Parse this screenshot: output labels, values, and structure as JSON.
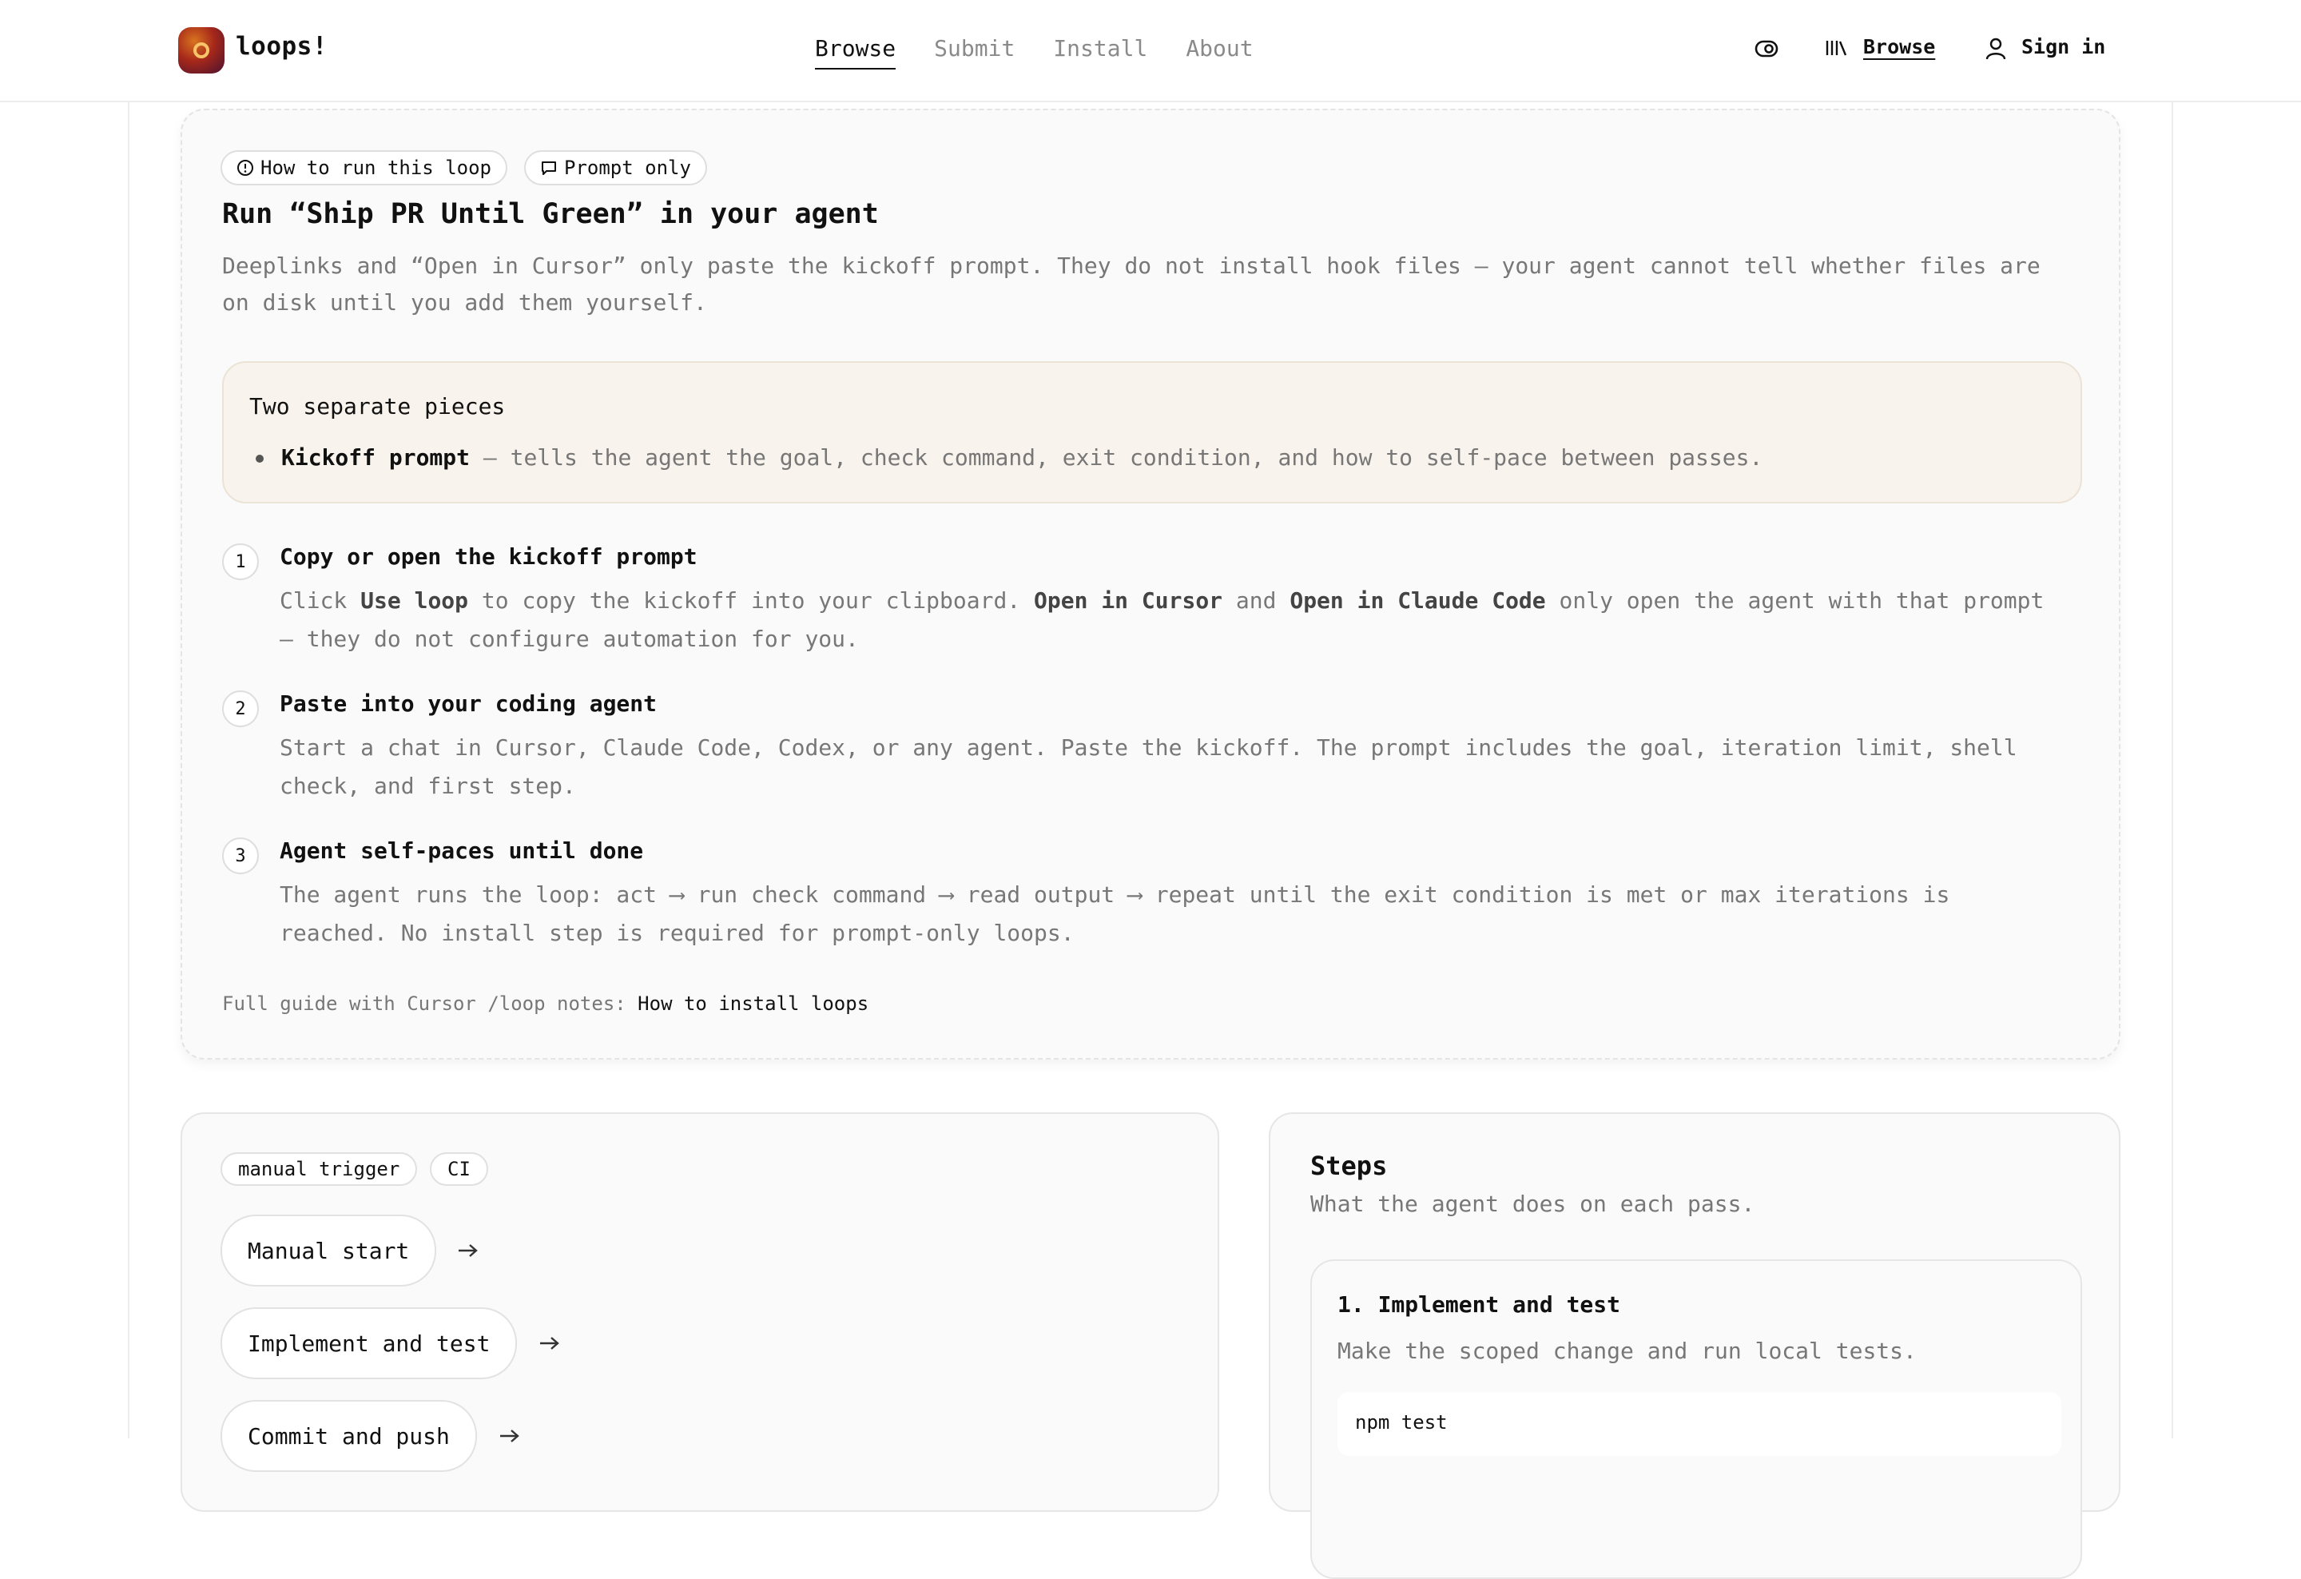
{
  "brand": {
    "name": "loops!"
  },
  "nav": {
    "items": [
      {
        "label": "Browse",
        "active": true
      },
      {
        "label": "Submit"
      },
      {
        "label": "Install"
      },
      {
        "label": "About"
      }
    ]
  },
  "header_right": {
    "browse_label": "Browse",
    "signin_label": "Sign in"
  },
  "howto": {
    "chip_run": "How to run this loop",
    "chip_prompt": "Prompt only",
    "title": "Run “Ship PR Until Green” in your agent",
    "description": "Deeplinks and “Open in Cursor” only paste the kickoff prompt. They do not install hook files — your agent cannot tell whether files are on disk until you add them yourself.",
    "pieces": {
      "title": "Two separate pieces",
      "item_bold": "Kickoff prompt",
      "item_text": " — tells the agent the goal, check command, exit condition, and how to self-pace between passes."
    },
    "steps": [
      {
        "num": "1",
        "title": "Copy or open the kickoff prompt",
        "p1": "Click ",
        "b1": "Use loop",
        "p2": " to copy the kickoff into your clipboard. ",
        "b2": "Open in Cursor",
        "p3": " and ",
        "b3": "Open in Claude Code",
        "p4": " only open the agent with that prompt — they do not configure automation for you."
      },
      {
        "num": "2",
        "title": "Paste into your coding agent",
        "body": "Start a chat in Cursor, Claude Code, Codex, or any agent. Paste the kickoff. The prompt includes the goal, iteration limit, shell check, and first step."
      },
      {
        "num": "3",
        "title": "Agent self-paces until done",
        "body": "The agent runs the loop: act ⟶ run check command ⟶ read output ⟶ repeat until the exit condition is met or max iterations is reached. No install step is required for prompt-only loops."
      }
    ],
    "guide_prefix": "Full guide with Cursor /loop notes: ",
    "guide_link": "How to install loops"
  },
  "flow": {
    "tags": [
      "manual trigger",
      "CI"
    ],
    "nodes": [
      "Manual start",
      "Implement and test",
      "Commit and push"
    ]
  },
  "steps_panel": {
    "title": "Steps",
    "subtitle": "What the agent does on each pass.",
    "items": [
      {
        "title": "1. Implement and test",
        "desc": "Make the scoped change and run local tests.",
        "code": "npm test"
      }
    ]
  },
  "icons": {
    "theme_toggle": "eye-toggle-icon",
    "library": "library-icon",
    "user": "user-icon",
    "info": "info-circle-icon",
    "chat": "chat-bubble-icon",
    "arrow": "arrow-right-icon"
  }
}
